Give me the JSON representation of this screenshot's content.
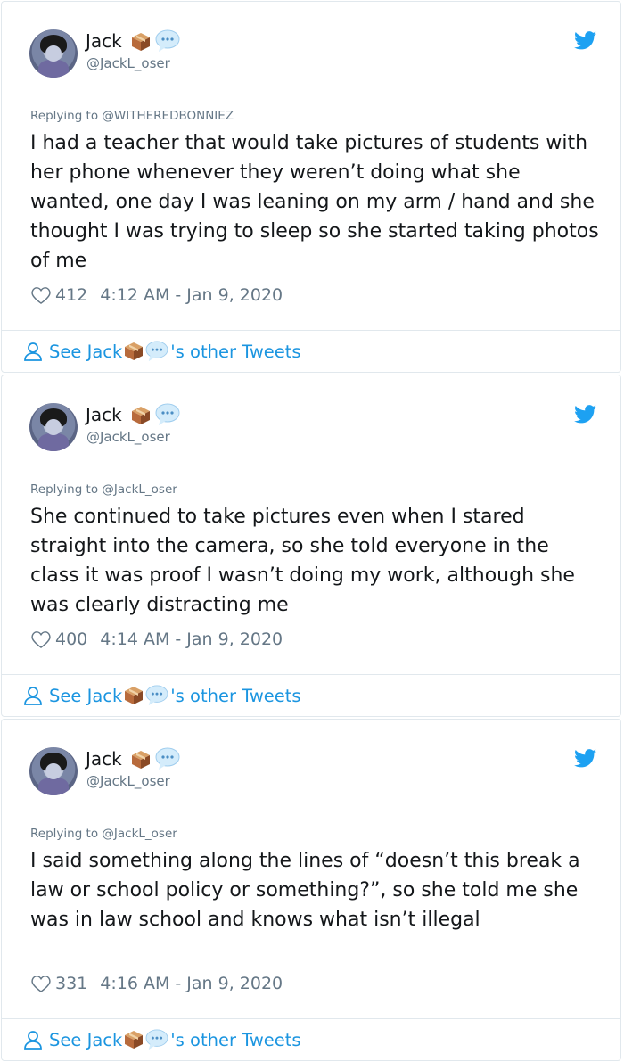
{
  "colors": {
    "link": "#1b95e0",
    "muted": "#657786",
    "text": "#14171a",
    "border": "#e1e8ed"
  },
  "icons": [
    "avatar-image",
    "package-box-emoji",
    "speech-bubble-emoji",
    "twitter-bird-icon",
    "heart-icon",
    "person-icon"
  ],
  "tweets": [
    {
      "name": "Jack",
      "handle": "@JackL_oser",
      "replying": "Replying to @WITHEREDBONNIEZ",
      "text": "I had a teacher that would take pictures of students with her phone whenever they weren’t doing what she wanted, one day I was leaning on my arm / hand and she thought I was trying to sleep so she started taking photos of me",
      "likes": "412",
      "timestamp": "4:12 AM - Jan 9, 2020",
      "see_prefix": "See Jack",
      "see_suffix": "'s other Tweets"
    },
    {
      "name": "Jack",
      "handle": "@JackL_oser",
      "replying": "Replying to @JackL_oser",
      "text": "She continued to take pictures even when I stared straight into the camera, so she told everyone in the class it was proof I wasn’t doing my work, although she was clearly distracting me",
      "likes": "400",
      "timestamp": "4:14 AM - Jan 9, 2020",
      "see_prefix": "See Jack",
      "see_suffix": "'s other Tweets"
    },
    {
      "name": "Jack",
      "handle": "@JackL_oser",
      "replying": "Replying to @JackL_oser",
      "text": "I said something along the lines of “doesn’t this break a law or school policy or something?”, so she told me she was in law school and knows what isn’t illegal",
      "likes": "331",
      "timestamp": "4:16 AM - Jan 9, 2020",
      "see_prefix": "See Jack",
      "see_suffix": "'s other Tweets"
    }
  ]
}
